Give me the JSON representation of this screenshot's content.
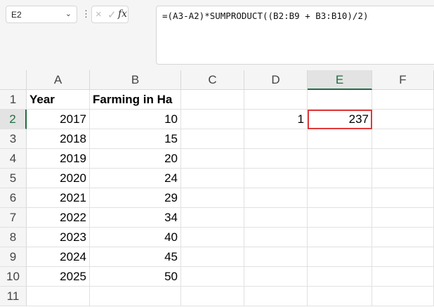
{
  "name_box": "E2",
  "formula": "=(A3-A2)*SUMPRODUCT((B2:B9 + B3:B10)/2)",
  "columns": [
    "A",
    "B",
    "C",
    "D",
    "E",
    "F"
  ],
  "rows": [
    {
      "n": "1",
      "A": "Year",
      "B": "Farming in Ha",
      "D": "",
      "E": ""
    },
    {
      "n": "2",
      "A": "2017",
      "B": "10",
      "D": "1",
      "E": "237"
    },
    {
      "n": "3",
      "A": "2018",
      "B": "15"
    },
    {
      "n": "4",
      "A": "2019",
      "B": "20"
    },
    {
      "n": "5",
      "A": "2020",
      "B": "24"
    },
    {
      "n": "6",
      "A": "2021",
      "B": "29"
    },
    {
      "n": "7",
      "A": "2022",
      "B": "34"
    },
    {
      "n": "8",
      "A": "2023",
      "B": "40"
    },
    {
      "n": "9",
      "A": "2024",
      "B": "45"
    },
    {
      "n": "10",
      "A": "2025",
      "B": "50"
    },
    {
      "n": "11"
    }
  ],
  "icons": {
    "cancel": "×",
    "enter": "✓",
    "fx": "fx",
    "chevron": "⌄",
    "more": "⋮"
  }
}
